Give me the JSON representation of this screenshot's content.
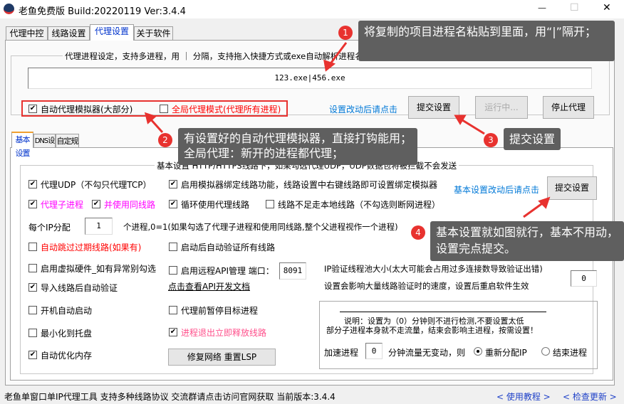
{
  "window": {
    "title": "老鱼免费版 Build:20220119 Ver:3.4.4",
    "minimize": "—",
    "maximize": "☐",
    "close": "✕"
  },
  "tabs": [
    {
      "label": "代理中控"
    },
    {
      "label": "线路设置"
    },
    {
      "label": "代理设置",
      "active": true
    },
    {
      "label": "关于软件"
    }
  ],
  "proxy_group": {
    "title": "代理进程设定，支持多进程，用 ｜ 分隔，支持拖入快捷方式或exe自动解析进程名，尽量把可能的子进程也拖进来，不区分大小写",
    "process_input": "123.exe|456.exe",
    "auto_sim": {
      "label": "自动代理模拟器(大部分)",
      "checked": true
    },
    "global_mode": {
      "label": "全局代理模式(代理所有进程)",
      "checked": false
    },
    "hint": "设置改动后请点击",
    "submit": "提交设置",
    "running": "运行中...",
    "stop": "停止代理"
  },
  "subtabs": [
    {
      "label": "基本设置",
      "active": true
    },
    {
      "label": "DNS设置"
    },
    {
      "label": "自定规则"
    }
  ],
  "basic": {
    "title": "基本设置  HTTP/HTTPS线路下，如果勾选代理UDP，UDP数据包将被拦截不会发送",
    "hint": "基本设置改动后请点击",
    "submit": "提交设置",
    "options": {
      "udp": {
        "label": "代理UDP（不勾只代理TCP）",
        "checked": true
      },
      "bind_sim": {
        "label": "启用模拟器绑定线路功能，线路设置中右键线路即可设置绑定模拟器",
        "checked": true
      },
      "child": {
        "label": "代理子进程",
        "checked": true
      },
      "same_line": {
        "label": "并使用同线路",
        "checked": true
      },
      "loop": {
        "label": "循环使用代理线路",
        "checked": true
      },
      "local": {
        "label": "线路不足走本地线路（不勾选则断网进程）",
        "checked": false
      },
      "skip_expired": {
        "label": "自动跳过过期线路(如果有)",
        "checked": false
      },
      "verify_start": {
        "label": "启动后自动验证所有线路",
        "checked": false
      },
      "virtual_hw": {
        "label": "启用虚拟硬件_如有异常别勾选",
        "checked": false
      },
      "remote_api": {
        "label": "启用远程API管理 端口：",
        "checked": false
      },
      "import_verify": {
        "label": "导入线路后自动验证",
        "checked": true
      },
      "autostart": {
        "label": "开机自动启动",
        "checked": false
      },
      "pause_target": {
        "label": "代理前暂停目标进程",
        "checked": false
      },
      "tray": {
        "label": "最小化到托盘",
        "checked": false
      },
      "release": {
        "label": "进程退出立即释放线路",
        "checked": true
      },
      "memory": {
        "label": "自动优化内存",
        "checked": true
      }
    },
    "ip_alloc_label": "每个IP分配",
    "ip_alloc_value": "1",
    "ip_alloc_desc": "个进程,0=1(如果勾选了代理子进程和使用同线路,整个父进程视作一个进程)",
    "port": "8091",
    "api_doc_link": "点击查看API开发文档",
    "pool_label1": "IP验证线程池大小(太大可能会占用过多连接数导致验证出错)",
    "pool_label2": "设置会影响大量线路验证时的速度，设置后重启软件生效",
    "pool_value": "0",
    "repair_button": "修复网络 重置LSP",
    "explain1": "说明：设置为（0）分钟则不进行检测,不要设置太低",
    "explain2": "部分子进程本身就不走流量，结束会影响主进程，按需设置！",
    "speed_label": "加速进程",
    "speed_value": "0",
    "speed_desc": "分钟流量无变动，则",
    "radio_realloc": "重新分配IP",
    "radio_end": "结束进程",
    "selected": "重新分配IP"
  },
  "status": {
    "text": "老鱼单窗口单IP代理工具 支持多种线路协议 交流群请点击访问官网获取  当前版本:3.4.4",
    "tutorial": "< 使用教程 >",
    "update": "< 检查更新 >"
  },
  "callouts": [
    {
      "num": "1",
      "text": "将复制的项目进程名粘贴到里面，用“|”隔开；"
    },
    {
      "num": "2",
      "line1": "有设置好的自动代理模拟器，直接打钩能用；",
      "line2": "全局代理：新开的进程都代理；"
    },
    {
      "num": "3",
      "text": "提交设置"
    },
    {
      "num": "4",
      "line1": "基本设置就如图就行，基本不用动，",
      "line2": "设置完点提交。"
    }
  ],
  "colors": {
    "accent_link": "#0078d7",
    "red": "#ff0000",
    "magenta": "#ff00ff",
    "pink": "#ff4f8b",
    "callout": "#5f5f5f",
    "badge": "#e8322f"
  }
}
